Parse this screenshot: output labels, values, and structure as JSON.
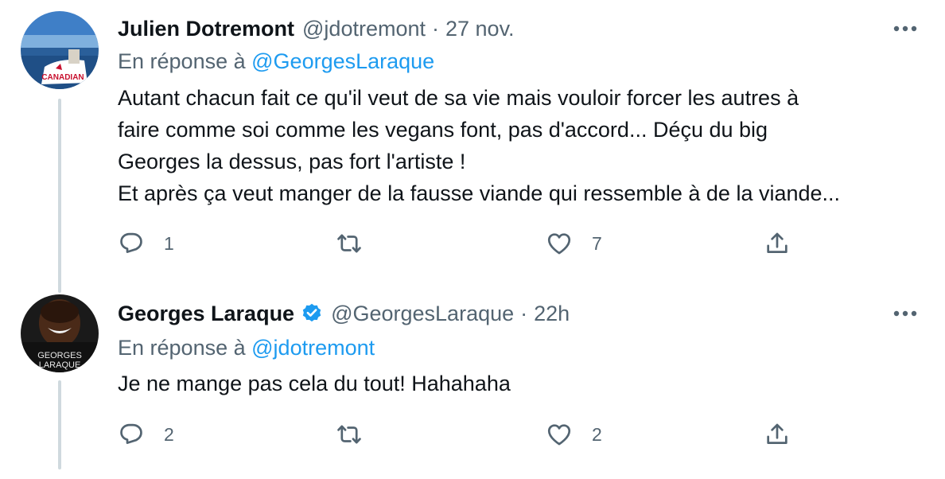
{
  "tweets": [
    {
      "author": "Julien Dotremont",
      "handle": "@jdotremont",
      "separator": "·",
      "time": "27 nov.",
      "reply_prefix": "En réponse à",
      "reply_to": "@GeorgesLaraque",
      "text_lines": [
        "Autant chacun fait ce qu'il veut de sa vie mais vouloir forcer les autres à",
        "faire comme soi comme les vegans font, pas d'accord... Déçu du big",
        "Georges la dessus, pas fort l'artiste !",
        "Et après ça veut manger de la fausse viande qui ressemble à de la viande..."
      ],
      "reply_count": "1",
      "retweet_count": "",
      "like_count": "7",
      "avatar_text": "CANADIAN"
    },
    {
      "author": "Georges Laraque",
      "verified": true,
      "handle": "@GeorgesLaraque",
      "separator": "·",
      "time": "22h",
      "reply_prefix": "En réponse à",
      "reply_to": "@jdotremont",
      "text_lines": [
        "Je ne mange pas cela du tout! Hahahaha"
      ],
      "reply_count": "2",
      "retweet_count": "",
      "like_count": "2",
      "avatar_text": [
        "GEORGES",
        "LARAQUE"
      ]
    }
  ],
  "icons": {
    "more": "more-horizontal-icon",
    "reply": "reply-icon",
    "retweet": "retweet-icon",
    "like": "like-icon",
    "share": "share-icon",
    "verified": "verified-badge-icon"
  },
  "colors": {
    "text": "#0f1419",
    "secondary": "#536471",
    "link": "#1d9bf0",
    "verified": "#1d9bf0",
    "thread_line": "#cfd9de"
  }
}
